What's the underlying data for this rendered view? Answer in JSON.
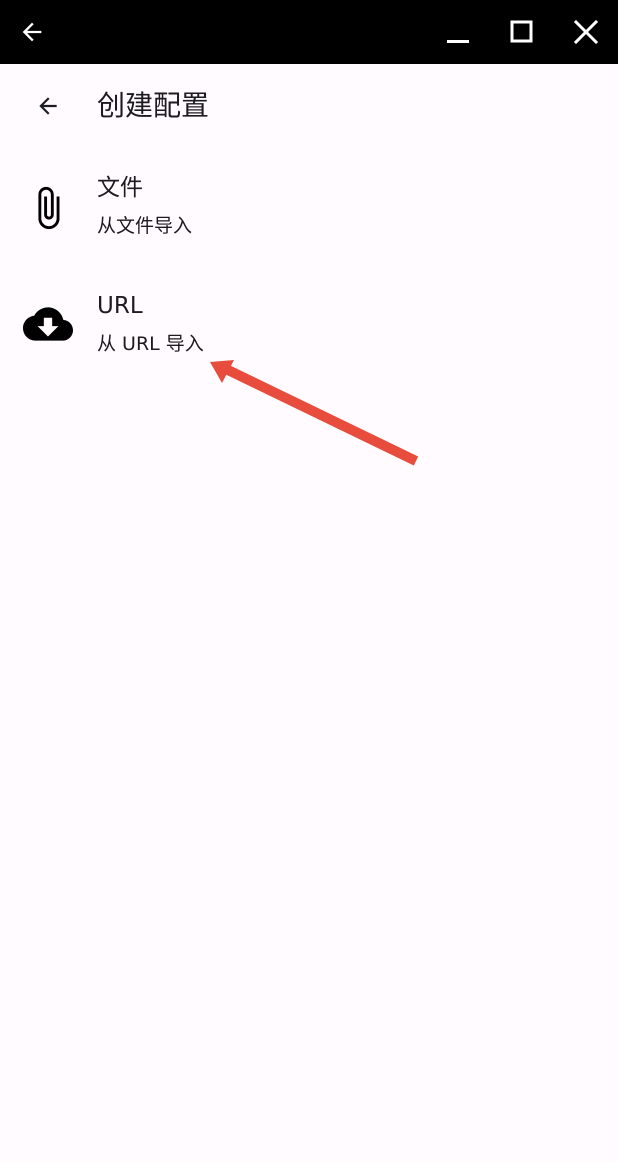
{
  "window_bar": {
    "back_icon": "arrow-left-icon",
    "minimize_icon": "minimize-icon",
    "maximize_icon": "maximize-icon",
    "close_icon": "close-icon"
  },
  "toolbar": {
    "back_icon": "arrow-left-icon",
    "title": "创建配置"
  },
  "items": [
    {
      "icon": "paperclip-icon",
      "title": "文件",
      "subtitle": "从文件导入"
    },
    {
      "icon": "cloud-download-icon",
      "title": "URL",
      "subtitle": "从 URL 导入"
    }
  ],
  "annotation": {
    "color": "#e74c3c",
    "icon": "red-arrow-annotation"
  }
}
